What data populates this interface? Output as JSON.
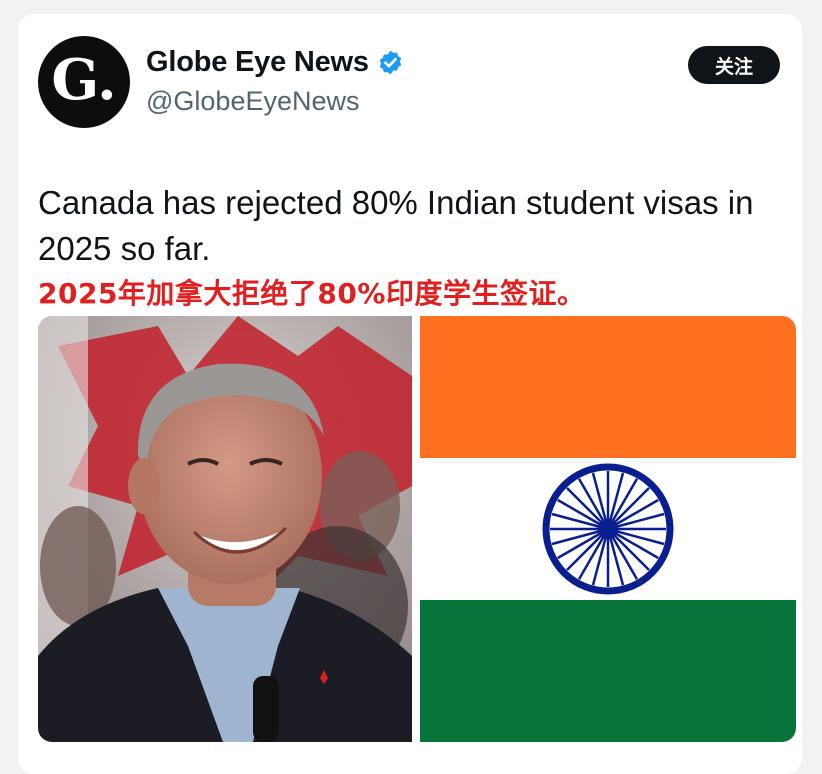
{
  "account": {
    "avatar_letter": "G.",
    "name": "Globe Eye News",
    "handle": "@GlobeEyeNews",
    "verified": true
  },
  "follow_button": {
    "label": "关注"
  },
  "tweet": {
    "text": "Canada has rejected 80% Indian student visas in 2025 so far.",
    "caption": "2025年加拿大拒绝了80%印度学生签证。"
  },
  "media": {
    "left": {
      "icon": "portrait-photo"
    },
    "right": {
      "icon": "india-flag",
      "colors": {
        "saffron": "#ff6f20",
        "white": "#ffffff",
        "green": "#07743a",
        "chakra": "#0a1f8f"
      }
    }
  },
  "colors": {
    "verified_blue": "#1d9bf0",
    "caption_red": "#e21f1f",
    "button_dark": "#0f1419"
  }
}
